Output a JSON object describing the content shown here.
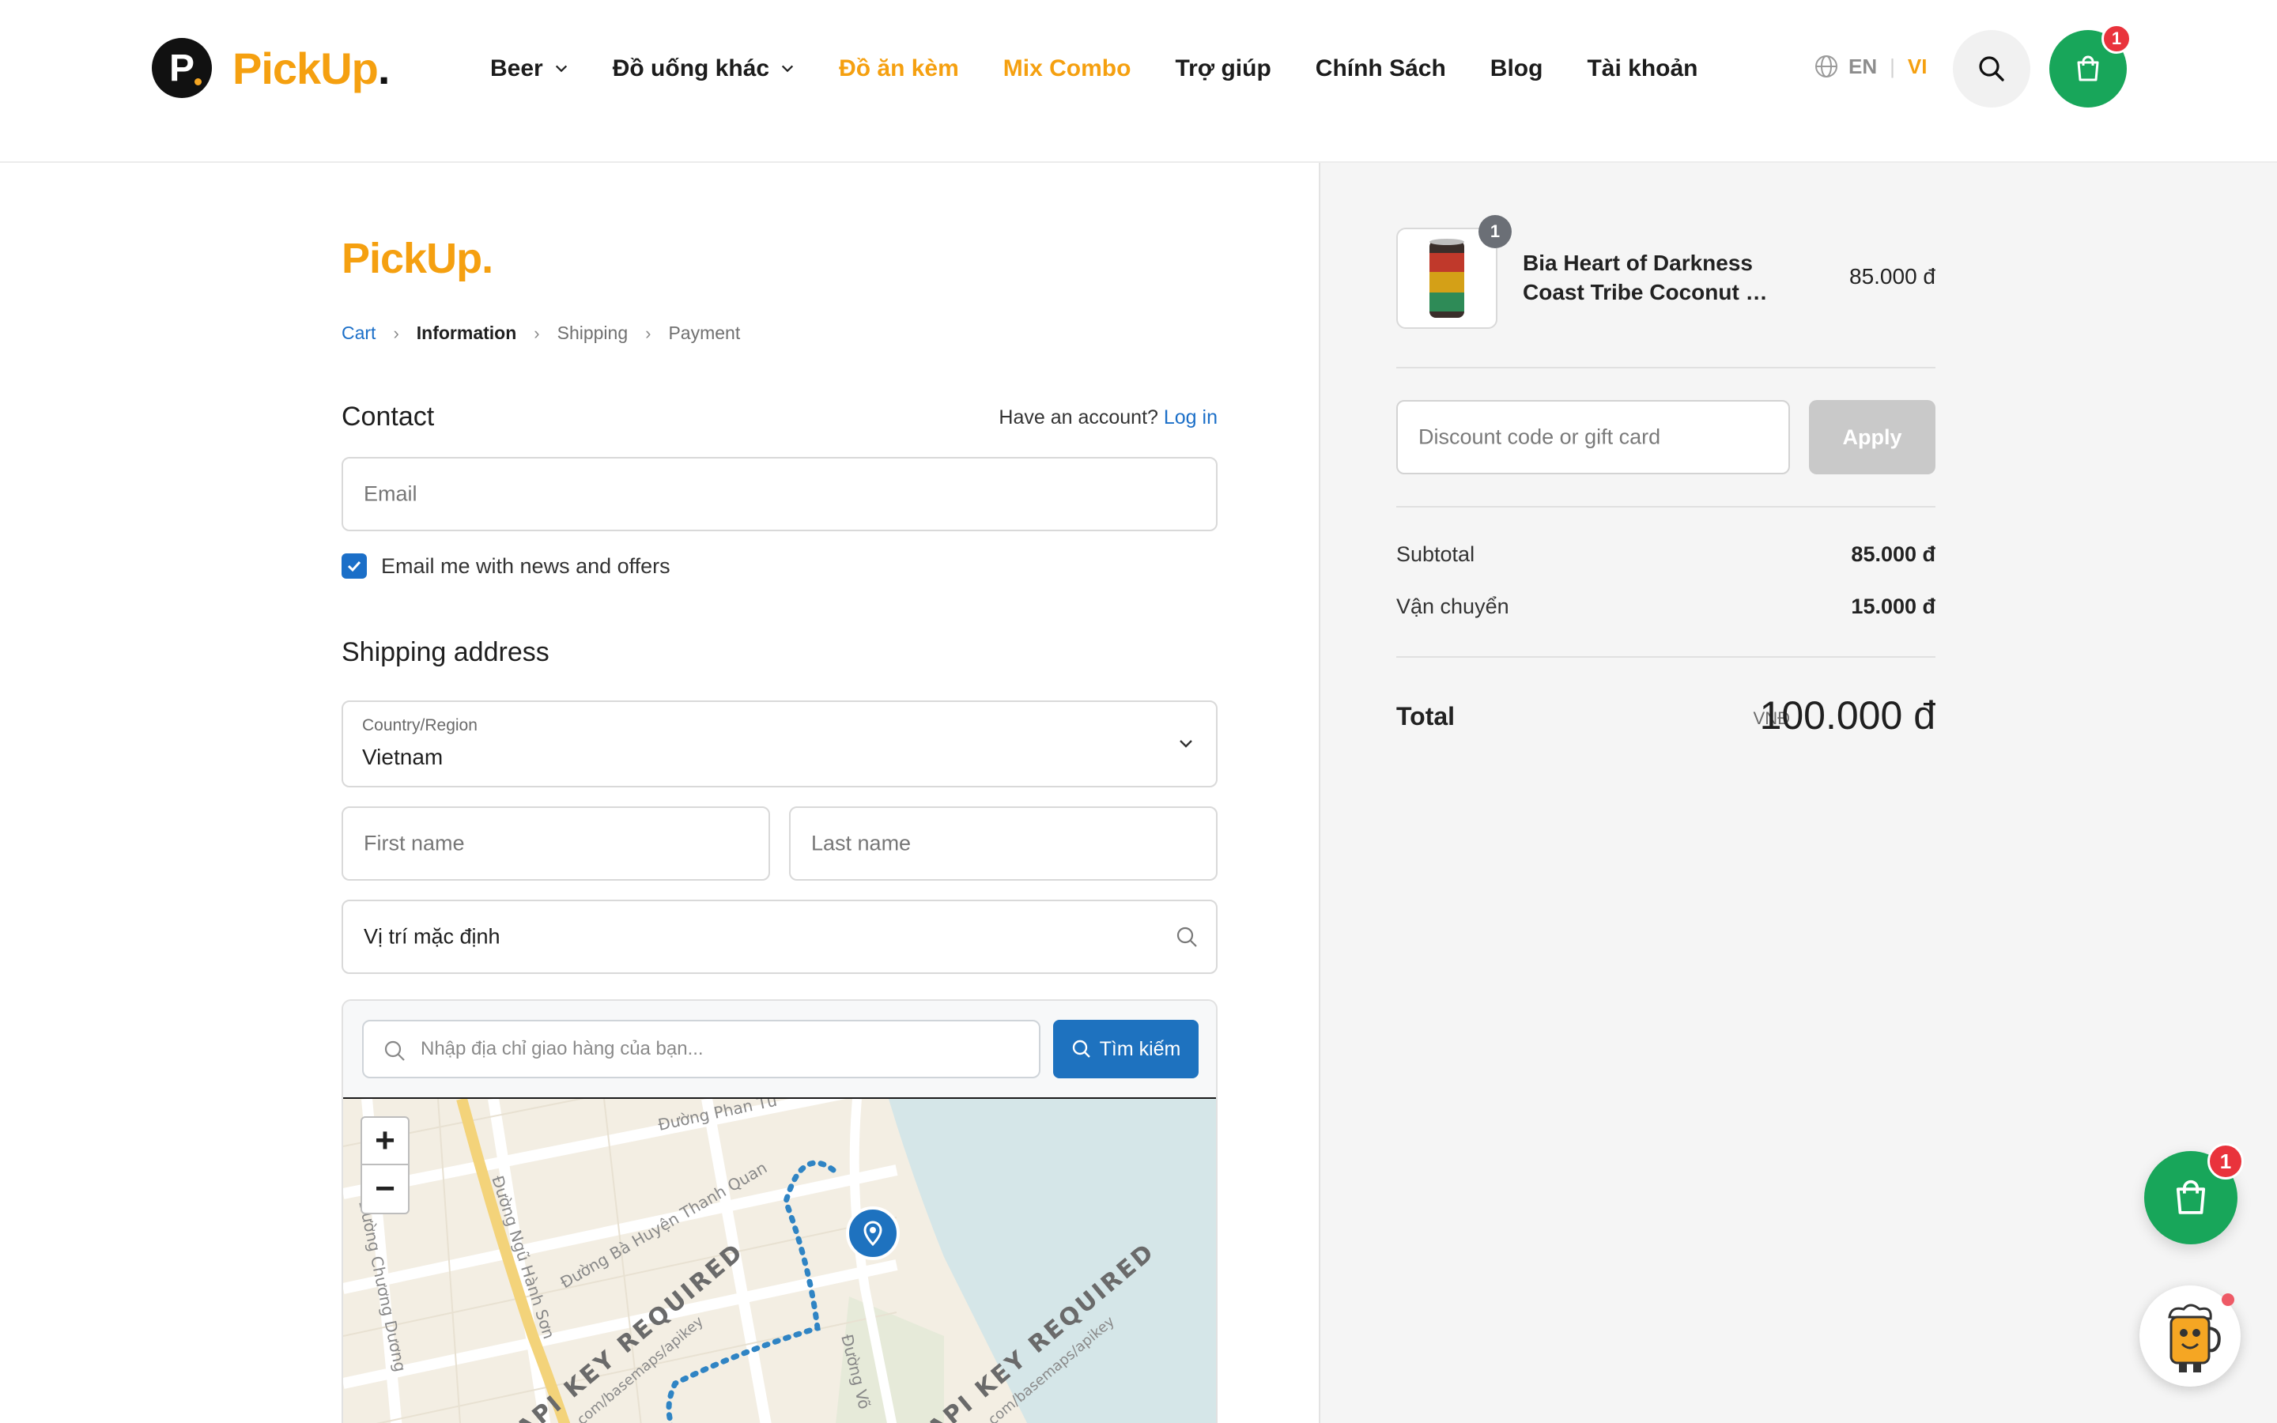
{
  "brand": {
    "badge_letter": "P",
    "name": "PickUp",
    "period": "."
  },
  "nav": {
    "items": [
      {
        "label": "Beer",
        "dropdown": true,
        "highlight": false
      },
      {
        "label": "Đồ uống khác",
        "dropdown": true,
        "highlight": false
      },
      {
        "label": "Đồ ăn kèm",
        "dropdown": false,
        "highlight": true
      },
      {
        "label": "Mix Combo",
        "dropdown": false,
        "highlight": true
      },
      {
        "label": "Trợ giúp",
        "dropdown": false,
        "highlight": false
      },
      {
        "label": "Chính Sách",
        "dropdown": false,
        "highlight": false
      },
      {
        "label": "Blog",
        "dropdown": false,
        "highlight": false
      },
      {
        "label": "Tài khoản",
        "dropdown": false,
        "highlight": false
      }
    ],
    "lang_en": "EN",
    "lang_sep": "|",
    "lang_vi": "VI",
    "cart_count": "1"
  },
  "checkout": {
    "logo": "PickUp.",
    "breadcrumb": {
      "cart": "Cart",
      "information": "Information",
      "shipping": "Shipping",
      "payment": "Payment"
    },
    "contact": {
      "title": "Contact",
      "have_account": "Have an account?",
      "login": "Log in",
      "email_placeholder": "Email",
      "newsletter_label": "Email me with news and offers",
      "newsletter_checked": true
    },
    "shipping_address": {
      "title": "Shipping address",
      "country_label": "Country/Region",
      "country_value": "Vietnam",
      "first_name_placeholder": "First name",
      "last_name_placeholder": "Last name",
      "location_value": "Vị trí mặc định"
    },
    "map": {
      "search_placeholder": "Nhập địa chỉ giao hàng của bạn...",
      "search_button": "Tìm kiếm",
      "zoom_in": "+",
      "zoom_out": "−",
      "streets": [
        "Đường Phan Tứ",
        "Đường Bà Huyện Thanh Quan",
        "Đường Ngũ Hành Sơn",
        "Đường Chương Dương",
        "Đường Võ"
      ],
      "watermark": "API KEY REQUIRED",
      "watermark_url": "arto.com/basemaps/apikey"
    }
  },
  "summary": {
    "product": {
      "qty": "1",
      "name_line1": "Bia Heart of Darkness",
      "name_line2": "Coast Tribe Coconut &...",
      "price": "85.000 đ"
    },
    "discount_placeholder": "Discount code or gift card",
    "apply_label": "Apply",
    "subtotal_label": "Subtotal",
    "subtotal_value": "85.000 đ",
    "shipping_label": "Vận chuyển",
    "shipping_value": "15.000 đ",
    "total_label": "Total",
    "total_currency": "VNĐ",
    "total_value": "100.000 đ"
  },
  "floating": {
    "cart_count": "1"
  },
  "colors": {
    "brand_orange": "#f5a010",
    "cart_green": "#18a65a",
    "link_blue": "#1b6fc8",
    "badge_red": "#e9333c"
  }
}
